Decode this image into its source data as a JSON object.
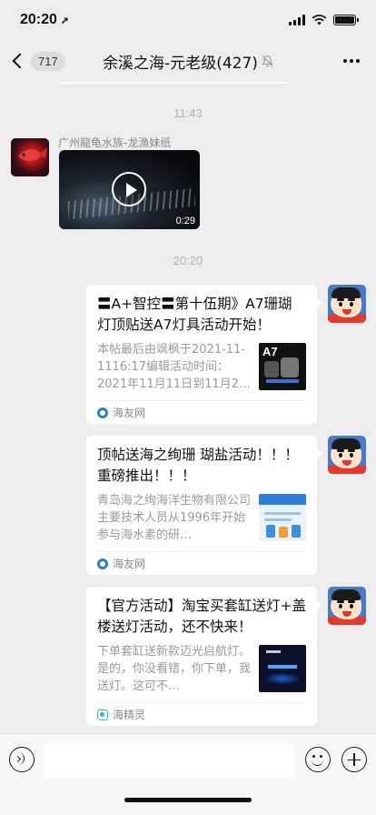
{
  "status_bar": {
    "time": "20:20",
    "location_glyph": "➚"
  },
  "nav": {
    "unread_count": "717",
    "title": "余溪之海-元老级(427)",
    "mute_icon": "bell-off-icon"
  },
  "chat": {
    "time_1": "11:43",
    "time_2": "20:20",
    "sender_name": "广州龍龟水族-龙渔妹纸",
    "video_duration": "0:29",
    "cards": [
      {
        "title": "〓A+智控〓第十伍期》A7珊瑚灯顶贴送A7灯具活动开始！",
        "desc": "本帖最后由飒枫于2021-11-1116:17编辑活动时间：2021年11月11日到11月2…",
        "thumb_label": "A7",
        "source": "海友网"
      },
      {
        "title": "顶帖送海之绚珊 瑚盐活动！！！ 重磅推出！！！",
        "desc": "青岛海之绚海洋生物有限公司主要技术人员从1996年开始参与海水素的研…",
        "source": "海友网"
      },
      {
        "title": "【官方活动】淘宝买套缸送灯+盖楼送灯活动，还不快来！",
        "desc": "下单套缸送新款迈光启航灯。是的，你没看错，你下单，我送灯。这可不…",
        "source": "海精灵"
      }
    ]
  },
  "input_bar": {
    "placeholder": ""
  }
}
